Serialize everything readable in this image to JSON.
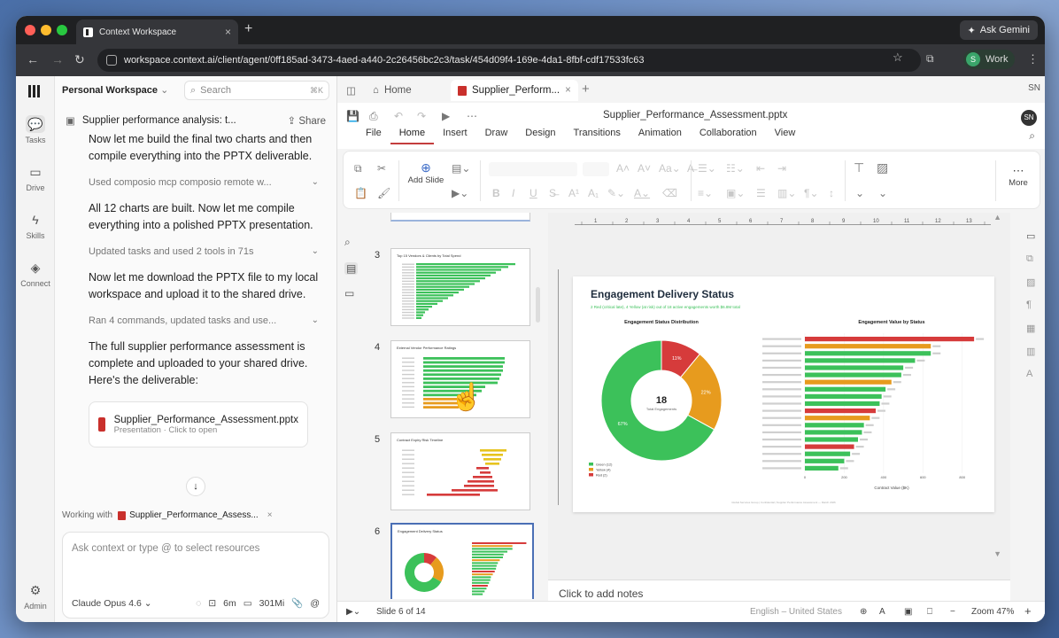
{
  "browser": {
    "tab_title": "Context Workspace",
    "gemini": "Ask Gemini",
    "url": "workspace.context.ai/client/agent/0ff185ad-3473-4aed-a440-2c26456bc2c3/task/454d09f4-169e-4da1-8fbf-cdf17533fc63",
    "profile_initial": "S",
    "profile": "Work"
  },
  "rail": {
    "tasks": "Tasks",
    "drive": "Drive",
    "skills": "Skills",
    "connect": "Connect",
    "admin": "Admin"
  },
  "chat": {
    "workspace": "Personal Workspace",
    "search_placeholder": "Search",
    "search_kbd": "⌘K",
    "thread_title": "Supplier performance analysis: t...",
    "share": "Share",
    "msg1": "Now let me build the final two charts and then compile everything into the PPTX deliverable.",
    "tool1": "Used composio mcp composio remote w...",
    "msg2": "All 12 charts are built. Now let me compile everything into a polished PPTX presentation.",
    "tool2": "Updated tasks and used 2 tools in 71s",
    "msg3": "Now let me download the PPTX file to my local workspace and upload it to the shared drive.",
    "tool3": "Ran 4 commands, updated tasks and use...",
    "msg4": "The full supplier performance assessment is complete and uploaded to your shared drive. Here's the deliverable:",
    "file_name": "Supplier_Performance_Assessment.pptx",
    "file_sub": "Presentation · Click to open",
    "working_label": "Working with",
    "working_file": "Supplier_Performance_Assess...",
    "input_placeholder": "Ask context or type @ to select resources",
    "model": "Claude Opus 4.6",
    "time": "6m",
    "tokens": "301Mi"
  },
  "app": {
    "home_tab": "Home",
    "file_tab": "Supplier_Perform...",
    "user": "SN",
    "doc_title": "Supplier_Performance_Assessment.pptx",
    "menus": [
      "File",
      "Home",
      "Insert",
      "Draw",
      "Design",
      "Transitions",
      "Animation",
      "Collaboration",
      "View"
    ],
    "add_slide": "Add Slide",
    "more": "More",
    "thumb_nums": [
      "3",
      "4",
      "5",
      "6"
    ],
    "thumb_titles": [
      "Top 15 Vendors & Clients by Total Spend",
      "External Vendor Performance Ratings",
      "Contract Expiry Risk Timeline",
      "Engagement Delivery Status"
    ],
    "notes": "Click to add notes",
    "slide_status": "Slide 6 of 14",
    "lang": "English – United States",
    "zoom": "Zoom 47%"
  },
  "slide": {
    "title": "Engagement Delivery Status",
    "subtitle": "2 Red (critical late), 4 Yellow (at risk) out of 18 active engagements worth $6.8M total",
    "donut_title": "Engagement Status Distribution",
    "bar_title": "Engagement Value by Status",
    "center_value": "18",
    "center_label": "Total Engagements",
    "legend": [
      "Green (12)",
      "Yellow (4)",
      "Red (2)"
    ],
    "xlabel": "Contract Value ($K)",
    "footer": "Global Services Group | Confidential | Supplier Performance Assessment — March 2026",
    "colors": {
      "green": "#3cc15a",
      "yellow": "#e79b1e",
      "red": "#d63b3b"
    }
  },
  "chart_data": [
    {
      "type": "pie",
      "title": "Engagement Status Distribution",
      "categories": [
        "Green",
        "Yellow",
        "Red"
      ],
      "values": [
        67,
        22,
        11
      ],
      "labels": [
        "67%",
        "22%",
        "11%"
      ]
    },
    {
      "type": "bar",
      "title": "Engagement Value by Status",
      "xlabel": "Contract Value ($K)",
      "xlim": [
        0,
        900
      ],
      "ticks": [
        "0",
        "200",
        "400",
        "600",
        "800"
      ],
      "values": [
        860,
        640,
        640,
        560,
        500,
        490,
        440,
        410,
        390,
        380,
        360,
        330,
        300,
        290,
        270,
        250,
        230,
        200,
        170
      ],
      "status": [
        "red",
        "yellow",
        "green",
        "green",
        "green",
        "green",
        "yellow",
        "green",
        "green",
        "green",
        "red",
        "yellow",
        "green",
        "green",
        "green",
        "red",
        "green",
        "green",
        "green"
      ]
    }
  ]
}
